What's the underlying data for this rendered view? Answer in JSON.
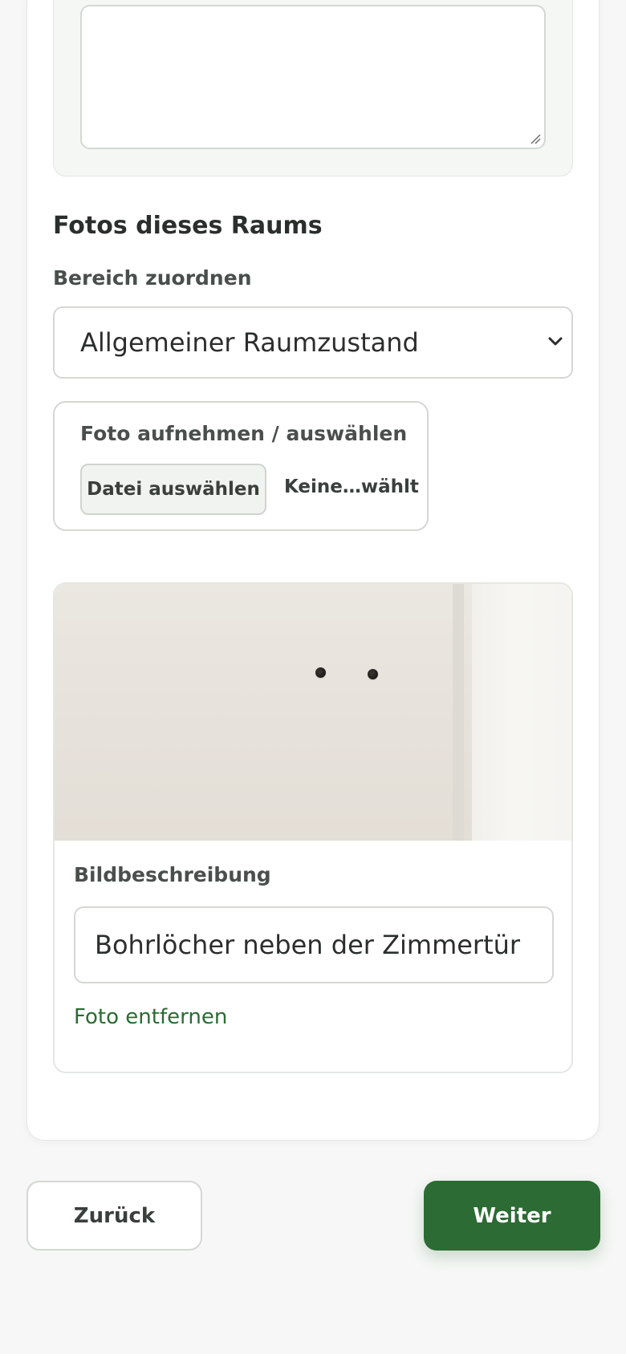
{
  "photos_section": {
    "title": "Fotos dieses Raums",
    "area_label": "Bereich zuordnen",
    "area_selected": "Allgemeiner Raumzustand",
    "upload_label": "Foto aufnehmen / auswählen",
    "file_button": "Datei auswählen",
    "file_status": "Keine…wählt"
  },
  "photo_item": {
    "description_label": "Bildbeschreibung",
    "description_value": "Bohrlöcher neben der Zimmertür",
    "remove_link": "Foto entfernen"
  },
  "navigation": {
    "back_label": "Zurück",
    "next_label": "Weiter"
  },
  "colors": {
    "accent": "#2c6b33",
    "link": "#2b6b35",
    "background": "#f6f7f6"
  }
}
